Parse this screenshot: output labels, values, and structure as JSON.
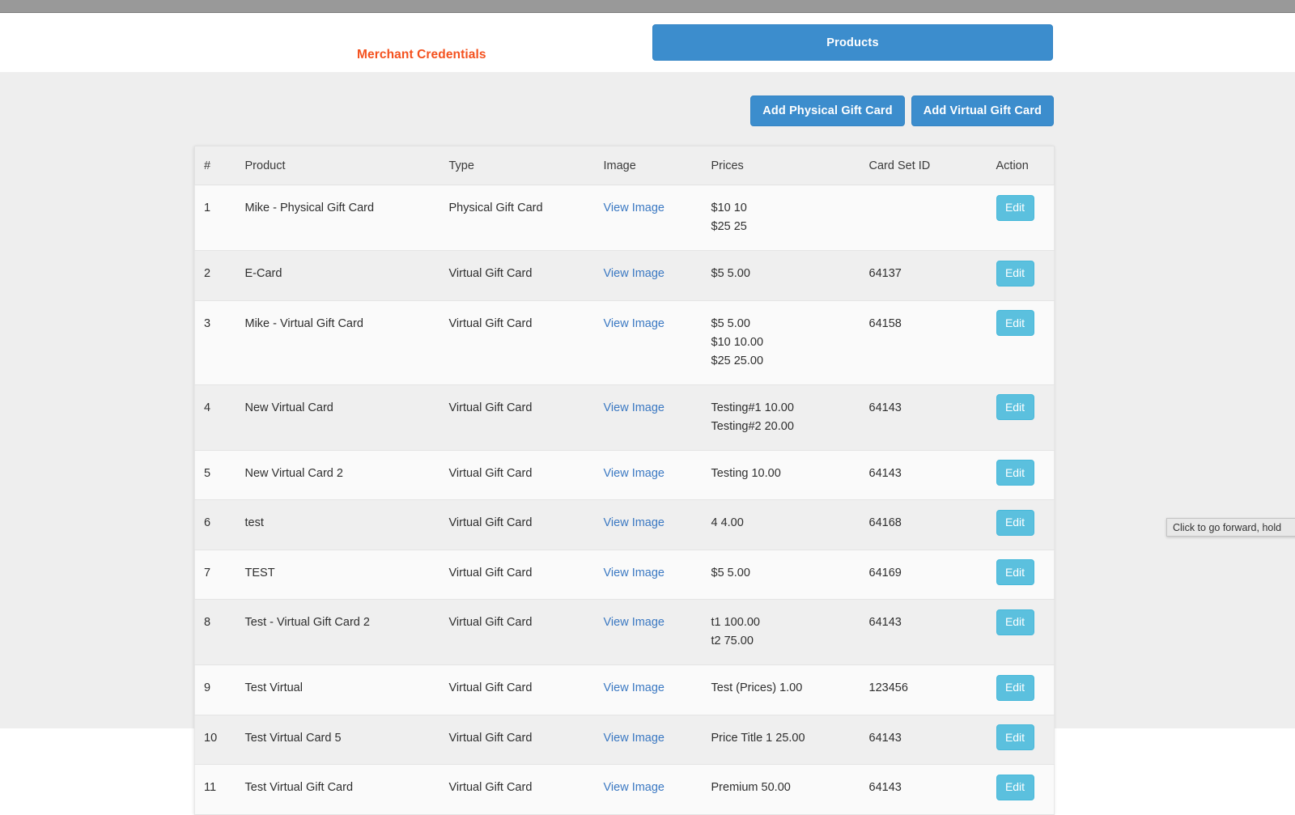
{
  "browser": {
    "tooltip_text": "Click to go forward, hold"
  },
  "nav": {
    "merchant_credentials_label": "Merchant Credentials",
    "products_tab_label": "Products",
    "accent_color": "#f4511e",
    "tab_color": "#3c8dcd"
  },
  "toolbar": {
    "add_physical_label": "Add Physical Gift Card",
    "add_virtual_label": "Add Virtual Gift Card"
  },
  "table": {
    "headers": {
      "num": "#",
      "product": "Product",
      "type": "Type",
      "image": "Image",
      "prices": "Prices",
      "card_set_id": "Card Set ID",
      "action": "Action"
    },
    "view_image_label": "View Image",
    "edit_label": "Edit",
    "rows": [
      {
        "num": "1",
        "product": "Mike - Physical Gift Card",
        "type": "Physical Gift Card",
        "image": "View Image",
        "prices": [
          "$10 10",
          "$25 25"
        ],
        "card_set_id": "",
        "action": "Edit"
      },
      {
        "num": "2",
        "product": "E-Card",
        "type": "Virtual Gift Card",
        "image": "View Image",
        "prices": [
          "$5 5.00"
        ],
        "card_set_id": "64137",
        "action": "Edit"
      },
      {
        "num": "3",
        "product": "Mike - Virtual Gift Card",
        "type": "Virtual Gift Card",
        "image": "View Image",
        "prices": [
          "$5 5.00",
          "$10 10.00",
          "$25 25.00"
        ],
        "card_set_id": "64158",
        "action": "Edit"
      },
      {
        "num": "4",
        "product": "New Virtual Card",
        "type": "Virtual Gift Card",
        "image": "View Image",
        "prices": [
          "Testing#1 10.00",
          "Testing#2 20.00"
        ],
        "card_set_id": "64143",
        "action": "Edit"
      },
      {
        "num": "5",
        "product": "New Virtual Card 2",
        "type": "Virtual Gift Card",
        "image": "View Image",
        "prices": [
          "Testing 10.00"
        ],
        "card_set_id": "64143",
        "action": "Edit"
      },
      {
        "num": "6",
        "product": "test",
        "type": "Virtual Gift Card",
        "image": "View Image",
        "prices": [
          "4 4.00"
        ],
        "card_set_id": "64168",
        "action": "Edit"
      },
      {
        "num": "7",
        "product": "TEST",
        "type": "Virtual Gift Card",
        "image": "View Image",
        "prices": [
          "$5 5.00"
        ],
        "card_set_id": "64169",
        "action": "Edit"
      },
      {
        "num": "8",
        "product": "Test - Virtual Gift Card 2",
        "type": "Virtual Gift Card",
        "image": "View Image",
        "prices": [
          "t1 100.00",
          "t2 75.00"
        ],
        "card_set_id": "64143",
        "action": "Edit"
      },
      {
        "num": "9",
        "product": "Test Virtual",
        "type": "Virtual Gift Card",
        "image": "View Image",
        "prices": [
          "Test (Prices) 1.00"
        ],
        "card_set_id": "123456",
        "action": "Edit"
      },
      {
        "num": "10",
        "product": "Test Virtual Card 5",
        "type": "Virtual Gift Card",
        "image": "View Image",
        "prices": [
          "Price Title 1 25.00"
        ],
        "card_set_id": "64143",
        "action": "Edit"
      },
      {
        "num": "11",
        "product": "Test Virtual Gift Card",
        "type": "Virtual Gift Card",
        "image": "View Image",
        "prices": [
          "Premium 50.00"
        ],
        "card_set_id": "64143",
        "action": "Edit"
      }
    ]
  }
}
